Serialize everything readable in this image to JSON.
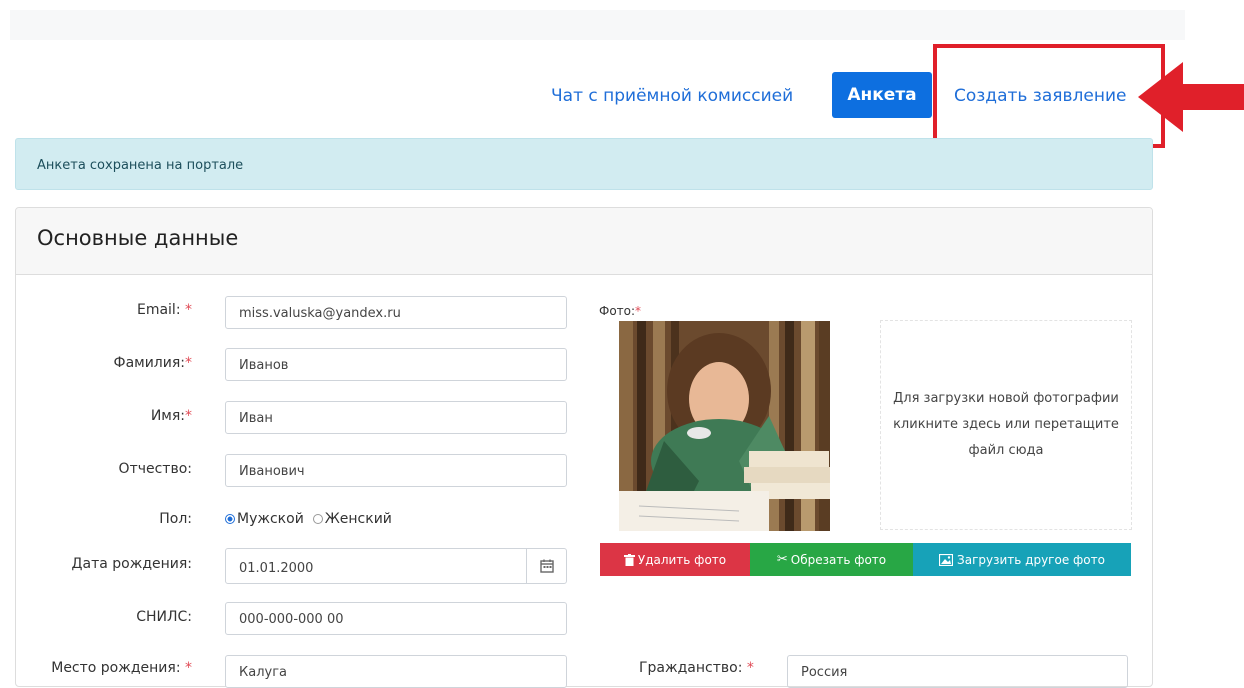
{
  "nav": {
    "chat": "Чат с приёмной комиссией",
    "active": "Анкета",
    "create": "Создать заявление"
  },
  "alert": {
    "text": "Анкета сохранена на портале"
  },
  "card": {
    "title": "Основные данные",
    "fields": {
      "email_label": "Email:",
      "email_value": "miss.valuska@yandex.ru",
      "lastname_label": "Фамилия:",
      "lastname_value": "Иванов",
      "firstname_label": "Имя:",
      "firstname_value": "Иван",
      "patronymic_label": "Отчество:",
      "patronymic_value": "Иванович",
      "gender_label": "Пол:",
      "gender_male": "Мужской",
      "gender_female": "Женский",
      "gender_selected": "male",
      "birthdate_label": "Дата рождения:",
      "birthdate_value": "01.01.2000",
      "snils_label": "СНИЛС:",
      "snils_value": "000-000-000 00",
      "birthplace_label": "Место рождения:",
      "birthplace_value": "Калуга",
      "required_mark": "*"
    },
    "photo": {
      "label": "Фото:",
      "dropzone_text": "Для загрузки новой фотографии кликните здесь или перетащите файл сюда",
      "delete_label": "Удалить фото",
      "crop_label": "Обрезать фото",
      "upload_label": "Загрузить другое фото"
    },
    "citizenship": {
      "label": "Гражданство:",
      "value": "Россия"
    }
  },
  "colors": {
    "primary": "#0d6fe0",
    "link": "#1f6ed8",
    "highlight": "#e0202a",
    "danger": "#dc3545",
    "success": "#28a745",
    "info": "#17a2b8",
    "alert_bg": "#d2ecf1"
  },
  "icons": {
    "calendar": "calendar-icon",
    "trash": "trash-icon",
    "scissors": "scissors-icon",
    "image": "image-icon",
    "arrow": "arrow-left-icon"
  }
}
